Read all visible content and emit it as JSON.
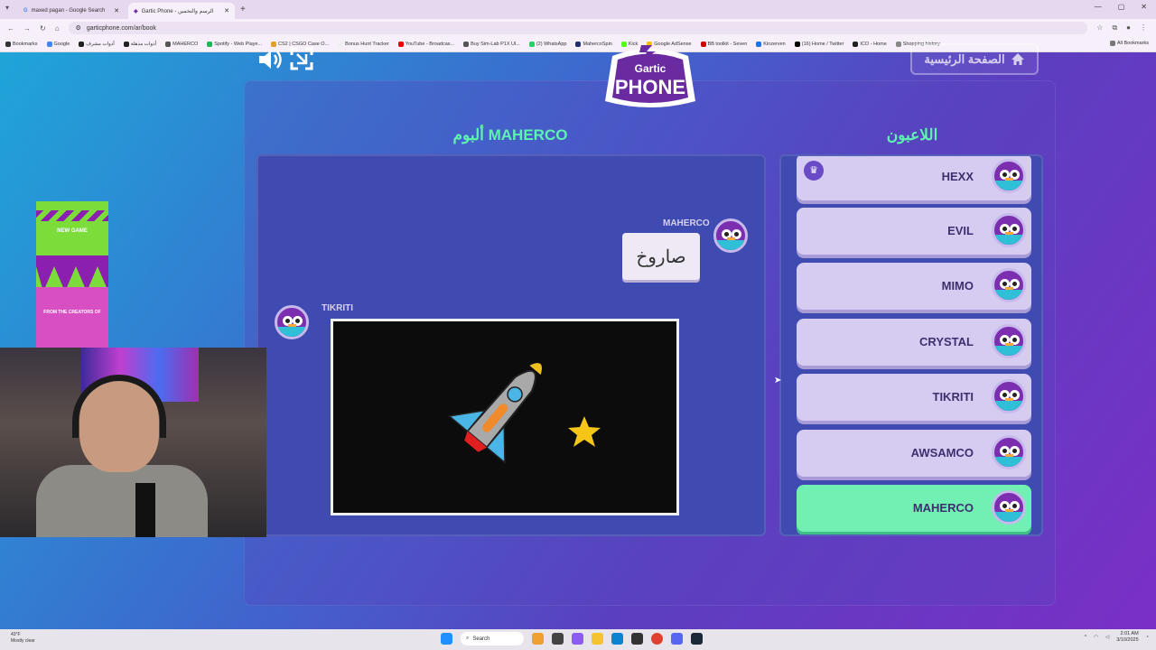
{
  "browser": {
    "tabs": [
      {
        "title": "maxed pagan - Google Search",
        "active": false
      },
      {
        "title": "Gartic Phone - الرسم والتخمين",
        "active": true
      }
    ],
    "url": "garticphone.com/ar/book",
    "bookmarks": [
      "Bookmarks",
      "Google",
      "أدوات مشرف",
      "أدوات مذهلة",
      "MAHERCO",
      "Spotify - Web Playe...",
      "CS2 | CSGO Case O...",
      "Bonus Hunt Tracker",
      "YouTube - Broadcas...",
      "Buy Sim-Lab P1X Ul...",
      "(2) WhatsApp",
      "MahercoSpin",
      "Kick",
      "Google AdSense",
      "BB toolkit - Seven",
      "Kinzerven",
      "(16) Home / Twitter",
      "ICO - Home",
      "Shopping history"
    ],
    "all_bookmarks": "All Bookmarks"
  },
  "game": {
    "home_button": "الصفحة الرئيسية",
    "album_title": "ألبوم MAHERCO",
    "players_title": "اللاعبون",
    "logo_line1": "Gartic",
    "logo_line2": "PHONE",
    "entries": [
      {
        "author": "MAHERCO",
        "type": "text",
        "text": "صاروخ"
      },
      {
        "author": "TIKRITI",
        "type": "drawing",
        "subject": "rocket"
      }
    ],
    "players": [
      {
        "name": "HEXX",
        "host": true,
        "me": false
      },
      {
        "name": "EVIL",
        "host": false,
        "me": false
      },
      {
        "name": "MIMO",
        "host": false,
        "me": false
      },
      {
        "name": "CRYSTAL",
        "host": false,
        "me": false
      },
      {
        "name": "TIKRITI",
        "host": false,
        "me": false
      },
      {
        "name": "AWSAMCO",
        "host": false,
        "me": false
      },
      {
        "name": "MAHERCO",
        "host": false,
        "me": true
      }
    ]
  },
  "ad": {
    "line1": "NEW GAME",
    "line2": "FROM THE CREATORS OF"
  },
  "taskbar": {
    "weather_temp": "43°F",
    "weather_desc": "Mostly clear",
    "search_placeholder": "Search",
    "time": "2:01 AM",
    "date": "3/10/2025"
  },
  "colors": {
    "accent": "#5ef3b0",
    "panel": "#3f4bb0",
    "player_card": "#d6ccf2",
    "me_card": "#72f0b4"
  }
}
